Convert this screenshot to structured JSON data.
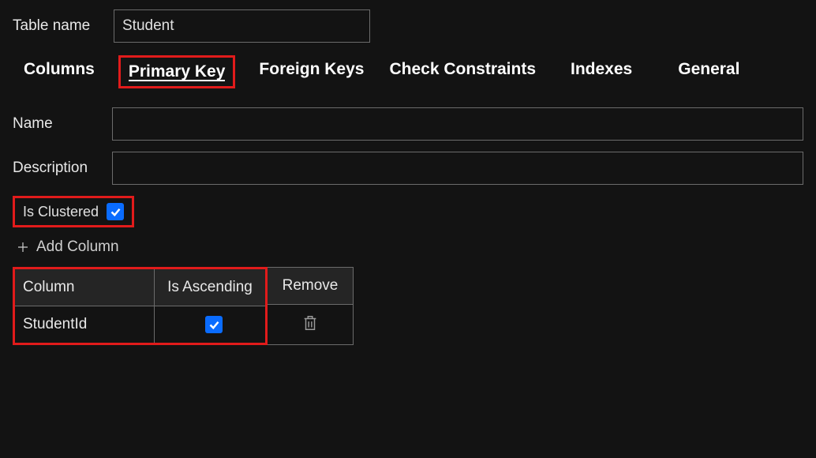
{
  "tableName": {
    "label": "Table name",
    "value": "Student"
  },
  "tabs": {
    "columns": "Columns",
    "primaryKey": "Primary Key",
    "foreignKeys": "Foreign Keys",
    "checkConstraints": "Check Constraints",
    "indexes": "Indexes",
    "general": "General"
  },
  "fields": {
    "nameLabel": "Name",
    "nameValue": "",
    "descLabel": "Description",
    "descValue": "",
    "isClusteredLabel": "Is Clustered",
    "isClusteredChecked": true
  },
  "addColumnLabel": "Add Column",
  "pkTable": {
    "headers": {
      "column": "Column",
      "isAscending": "Is Ascending",
      "remove": "Remove"
    },
    "row": {
      "column": "StudentId",
      "isAscending": true
    }
  }
}
